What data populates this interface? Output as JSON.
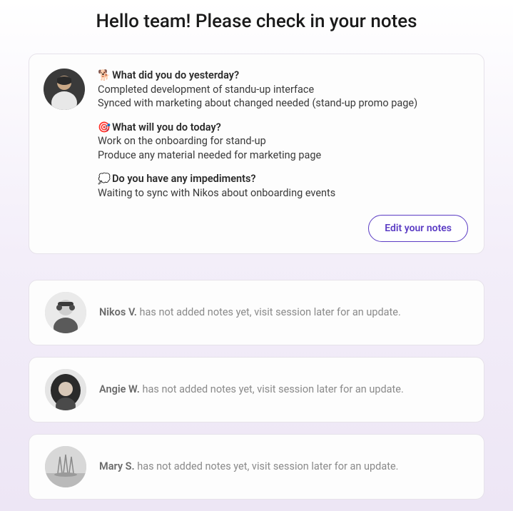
{
  "header": {
    "title": "Hello team! Please check in your notes"
  },
  "main_note": {
    "sections": [
      {
        "emoji": "🐕",
        "question": "What did you do yesterday?",
        "answers": [
          "Completed development of standu-up interface",
          "Synced with marketing about changed needed (stand-up promo page)"
        ]
      },
      {
        "emoji": "🎯",
        "question": "What will you do today?",
        "answers": [
          "Work on the onboarding for stand-up",
          "Produce any material needed for marketing page"
        ]
      },
      {
        "emoji": "💭",
        "question": "Do you have any impediments?",
        "answers": [
          "Waiting to sync with Nikos about onboarding events"
        ]
      }
    ],
    "edit_button_label": "Edit your notes"
  },
  "pending": [
    {
      "name": "Nikos V.",
      "message": " has not added notes yet, visit session later for an update."
    },
    {
      "name": "Angie W.",
      "message": " has not added notes yet, visit session later for an update."
    },
    {
      "name": "Mary S.",
      "message": " has not added notes yet, visit session later for an update."
    }
  ]
}
